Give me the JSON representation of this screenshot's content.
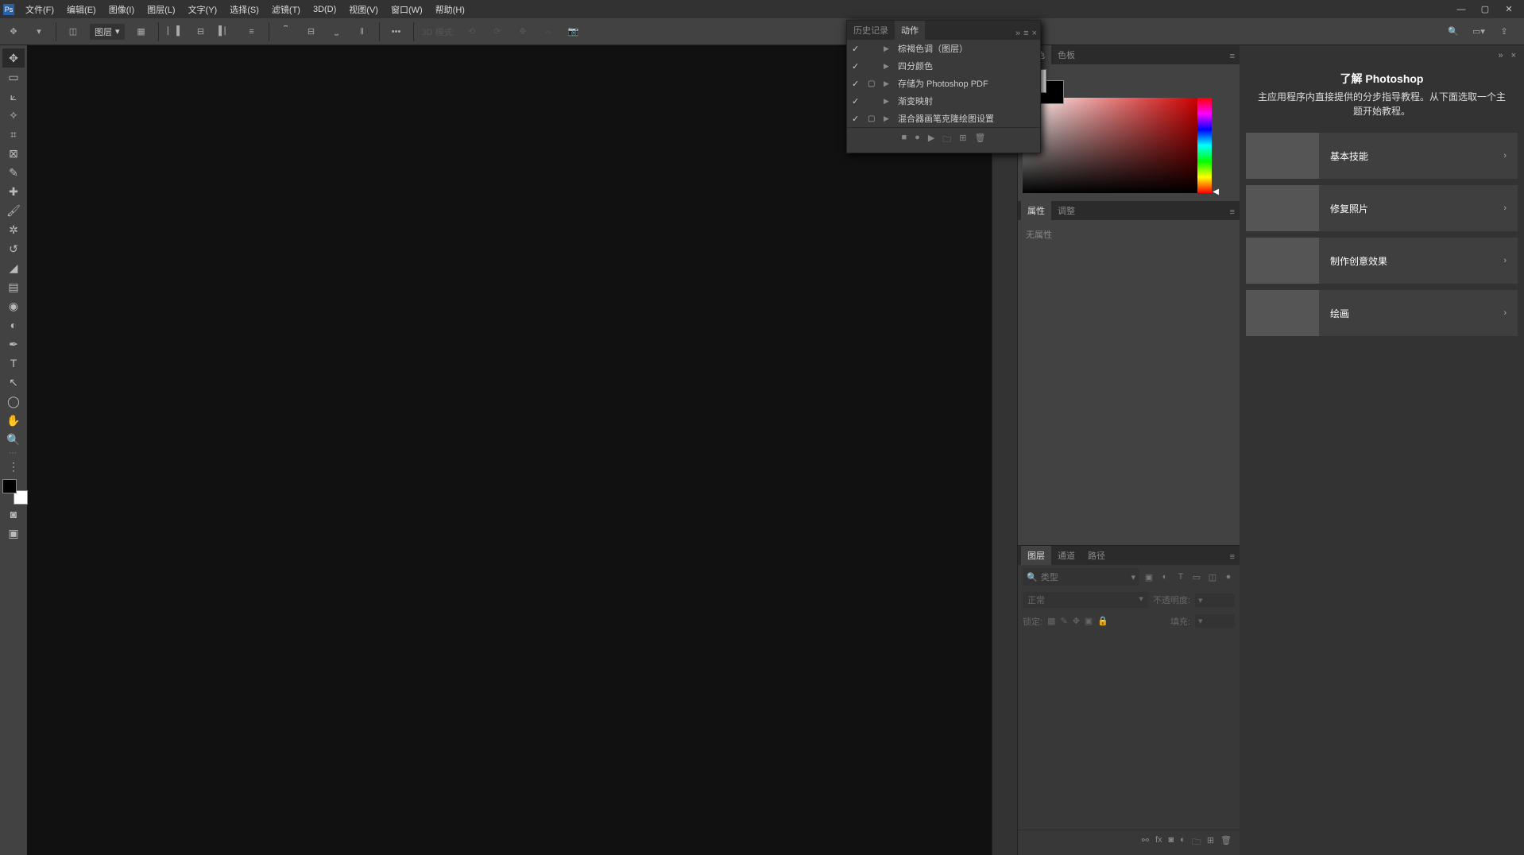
{
  "app": {
    "logo": "Ps"
  },
  "menu": {
    "items": [
      {
        "label": "文件(F)"
      },
      {
        "label": "编辑(E)"
      },
      {
        "label": "图像(I)"
      },
      {
        "label": "图层(L)"
      },
      {
        "label": "文字(Y)"
      },
      {
        "label": "选择(S)"
      },
      {
        "label": "滤镜(T)"
      },
      {
        "label": "3D(D)"
      },
      {
        "label": "视图(V)"
      },
      {
        "label": "窗口(W)"
      },
      {
        "label": "帮助(H)"
      }
    ]
  },
  "options": {
    "mode_label": "图层",
    "threeD_label": "3D 模式:"
  },
  "panels": {
    "color_tabs": {
      "color": "颜色",
      "swatches": "色板"
    },
    "properties_tabs": {
      "properties": "属性",
      "adjustments": "调整"
    },
    "properties_body": "无属性",
    "layers_tabs": {
      "layers": "图层",
      "channels": "通道",
      "paths": "路径"
    },
    "layers_filter_placeholder": "类型",
    "layers_blend": "正常",
    "layers_opacity_label": "不透明度:",
    "layers_lock_label": "锁定:",
    "layers_fill_label": "填充:"
  },
  "actions_popup": {
    "tabs": {
      "history": "历史记录",
      "actions": "动作"
    },
    "rows": [
      {
        "label": "棕褐色调（图层）"
      },
      {
        "label": "四分颜色"
      },
      {
        "label": "存储为 Photoshop PDF",
        "dialog": true
      },
      {
        "label": "渐变映射"
      },
      {
        "label": "混合器画笔克隆绘图设置",
        "dialog": true
      }
    ]
  },
  "learn": {
    "close": "×",
    "title": "了解 Photoshop",
    "desc": "主应用程序内直接提供的分步指导教程。从下面选取一个主题开始教程。",
    "cards": [
      {
        "label": "基本技能"
      },
      {
        "label": "修复照片"
      },
      {
        "label": "制作创意效果"
      },
      {
        "label": "绘画"
      }
    ]
  }
}
